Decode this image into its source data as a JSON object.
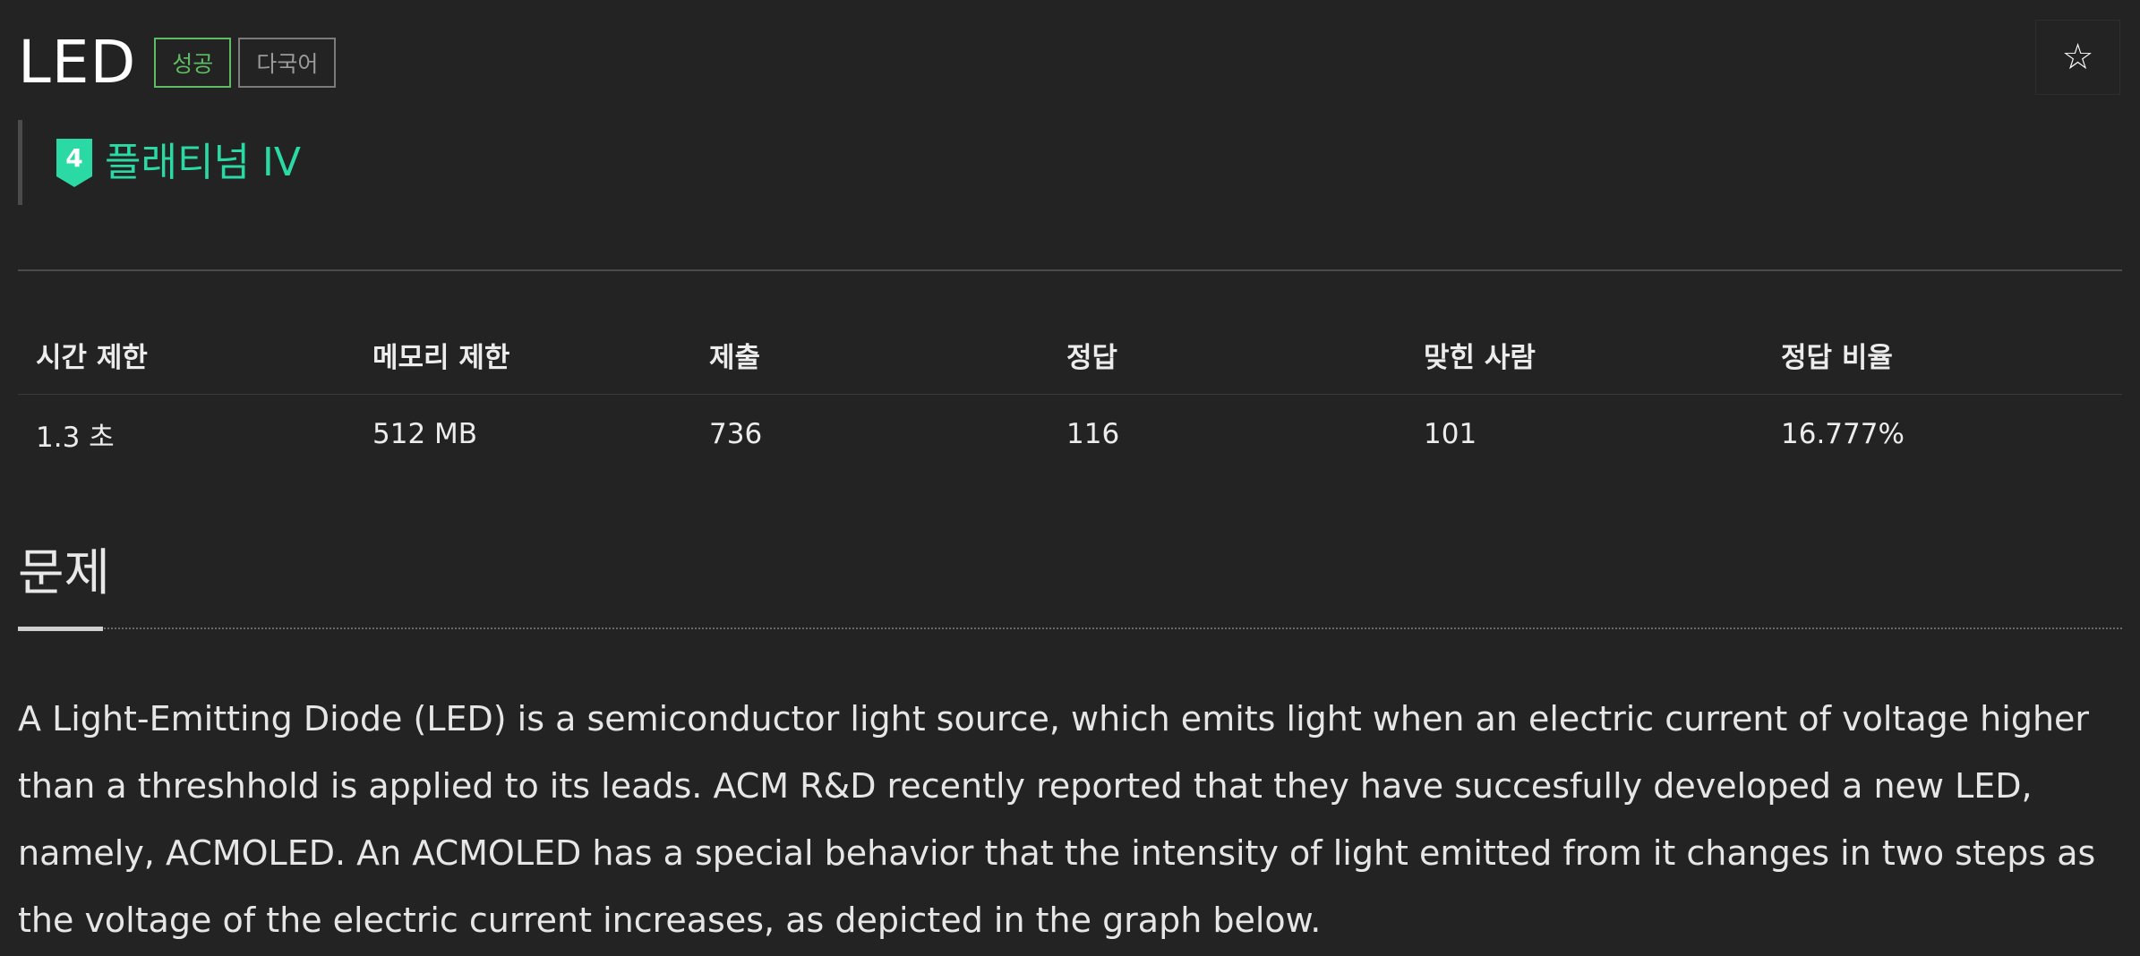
{
  "problem": {
    "title": "LED",
    "badges": {
      "success": "성공",
      "multilang": "다국어"
    },
    "star_glyph": "☆"
  },
  "tier": {
    "number": "4",
    "label": "플래티넘 IV",
    "color": "#2bd9a5"
  },
  "stats": {
    "headers": [
      "시간 제한",
      "메모리 제한",
      "제출",
      "정답",
      "맞힌 사람",
      "정답 비율"
    ],
    "values": [
      "1.3 초",
      "512 MB",
      "736",
      "116",
      "101",
      "16.777%"
    ]
  },
  "section": {
    "title": "문제"
  },
  "description": "A Light-Emitting Diode (LED) is a semiconductor light source, which emits light when an electric current of voltage higher than a threshhold is applied to its leads. ACM R&D recently reported that they have succesfully developed a new LED, namely, ACMOLED. An ACMOLED has a special behavior that the intensity of light emitted from it changes in two steps as the voltage of the electric current increases, as depicted in the graph below.",
  "colors": {
    "background": "#232323",
    "success": "#5dbb63",
    "tier": "#2bd9a5"
  }
}
